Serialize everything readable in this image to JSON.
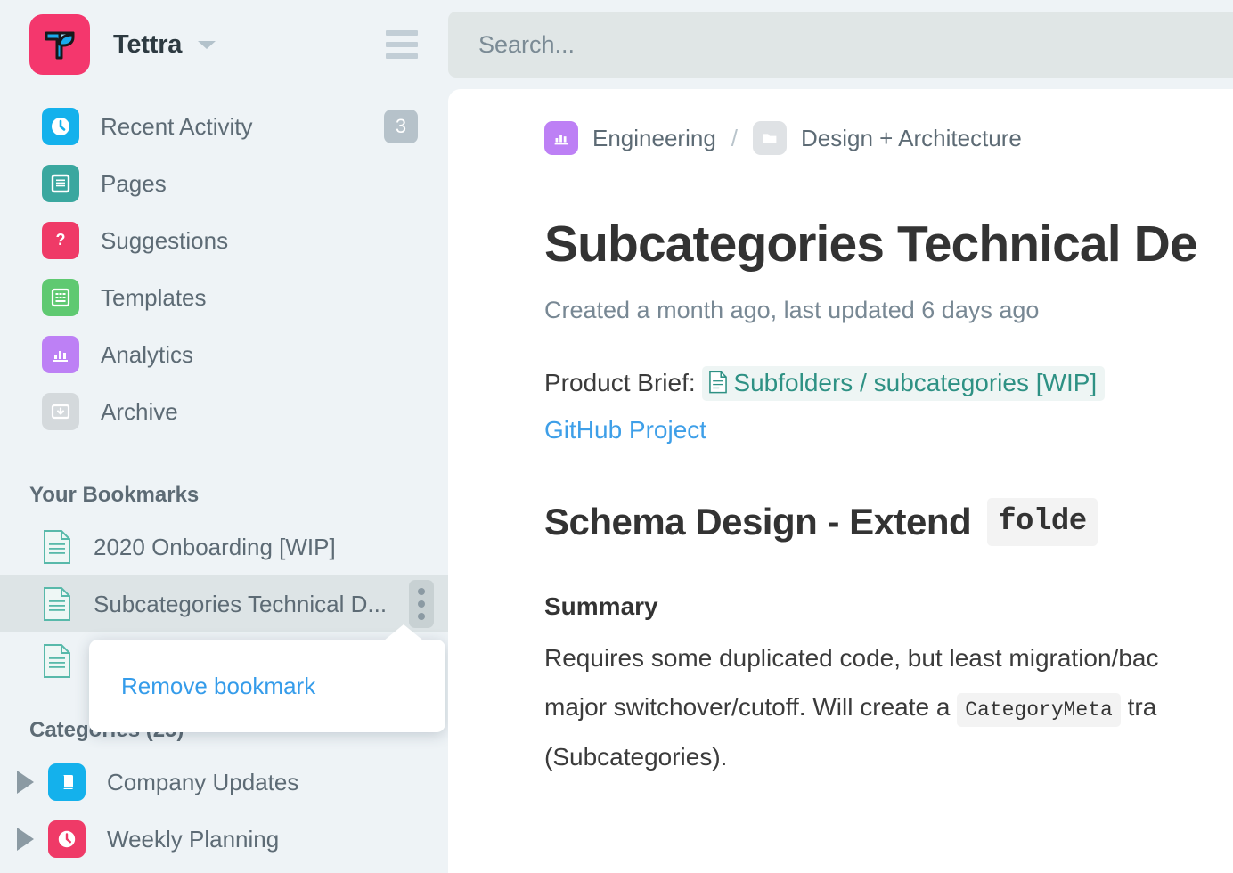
{
  "sidebar": {
    "brand": {
      "name": "Tettra",
      "logo_color": "#f4376d",
      "caret_icon": "chevron-down-icon",
      "menu_icon": "hamburger-icon"
    },
    "nav": [
      {
        "label": "Recent Activity",
        "icon": "clock-icon",
        "color": "#14b1ec",
        "badge": "3"
      },
      {
        "label": "Pages",
        "icon": "document-icon",
        "color": "#3aa79f",
        "badge": ""
      },
      {
        "label": "Suggestions",
        "icon": "question-icon",
        "color": "#ef3a67",
        "badge": ""
      },
      {
        "label": "Templates",
        "icon": "template-icon",
        "color": "#5fc971",
        "badge": ""
      },
      {
        "label": "Analytics",
        "icon": "bar-chart-icon",
        "color": "#bd80f5",
        "badge": ""
      },
      {
        "label": "Archive",
        "icon": "archive-box-icon",
        "color": "#d4d9dc",
        "badge": ""
      }
    ],
    "bookmarks_title": "Your Bookmarks",
    "bookmarks": [
      {
        "label": "2020 Onboarding [WIP]",
        "icon": "page-icon",
        "active": false
      },
      {
        "label": "Subcategories Technical D...",
        "icon": "page-icon",
        "active": true
      },
      {
        "label": "",
        "icon": "page-icon",
        "active": false
      }
    ],
    "bookmark_menu_icon": "kebab-menu-icon",
    "categories_title": "Categories (25)",
    "categories": [
      {
        "label": "Company Updates",
        "icon": "book-icon",
        "color": "#14b1ec",
        "caret": "triangle-right-icon"
      },
      {
        "label": "Weekly Planning",
        "icon": "clock-icon",
        "color": "#ef3a67",
        "caret": "triangle-right-icon"
      }
    ]
  },
  "popover": {
    "item_label": "Remove bookmark",
    "accent_color": "#359cea"
  },
  "search": {
    "placeholder": "Search...",
    "value": ""
  },
  "main": {
    "breadcrumb": [
      {
        "label": "Engineering",
        "icon": "bar-chart-icon",
        "color": "#bd80f5"
      },
      {
        "label": "Design + Architecture",
        "icon": "folder-icon",
        "color": "#dfe2e5"
      }
    ],
    "breadcrumb_separator": "/",
    "title": "Subcategories Technical De",
    "meta": "Created a month ago, last updated 6 days ago",
    "product_brief_label": "Product Brief:",
    "product_brief_link": "Subfolders / subcategories [WIP]",
    "product_brief_icon": "page-icon",
    "github_link": "GitHub Project",
    "heading": "Schema Design - Extend",
    "heading_code": "folde",
    "summary_heading": "Summary",
    "summary_line1": "Requires some duplicated code, but least migration/bac",
    "summary_line2_a": "major switchover/cutoff. Will create a",
    "summary_line2_code": "CategoryMeta",
    "summary_line2_b": "tra",
    "summary_line3": "(Subcategories)."
  }
}
